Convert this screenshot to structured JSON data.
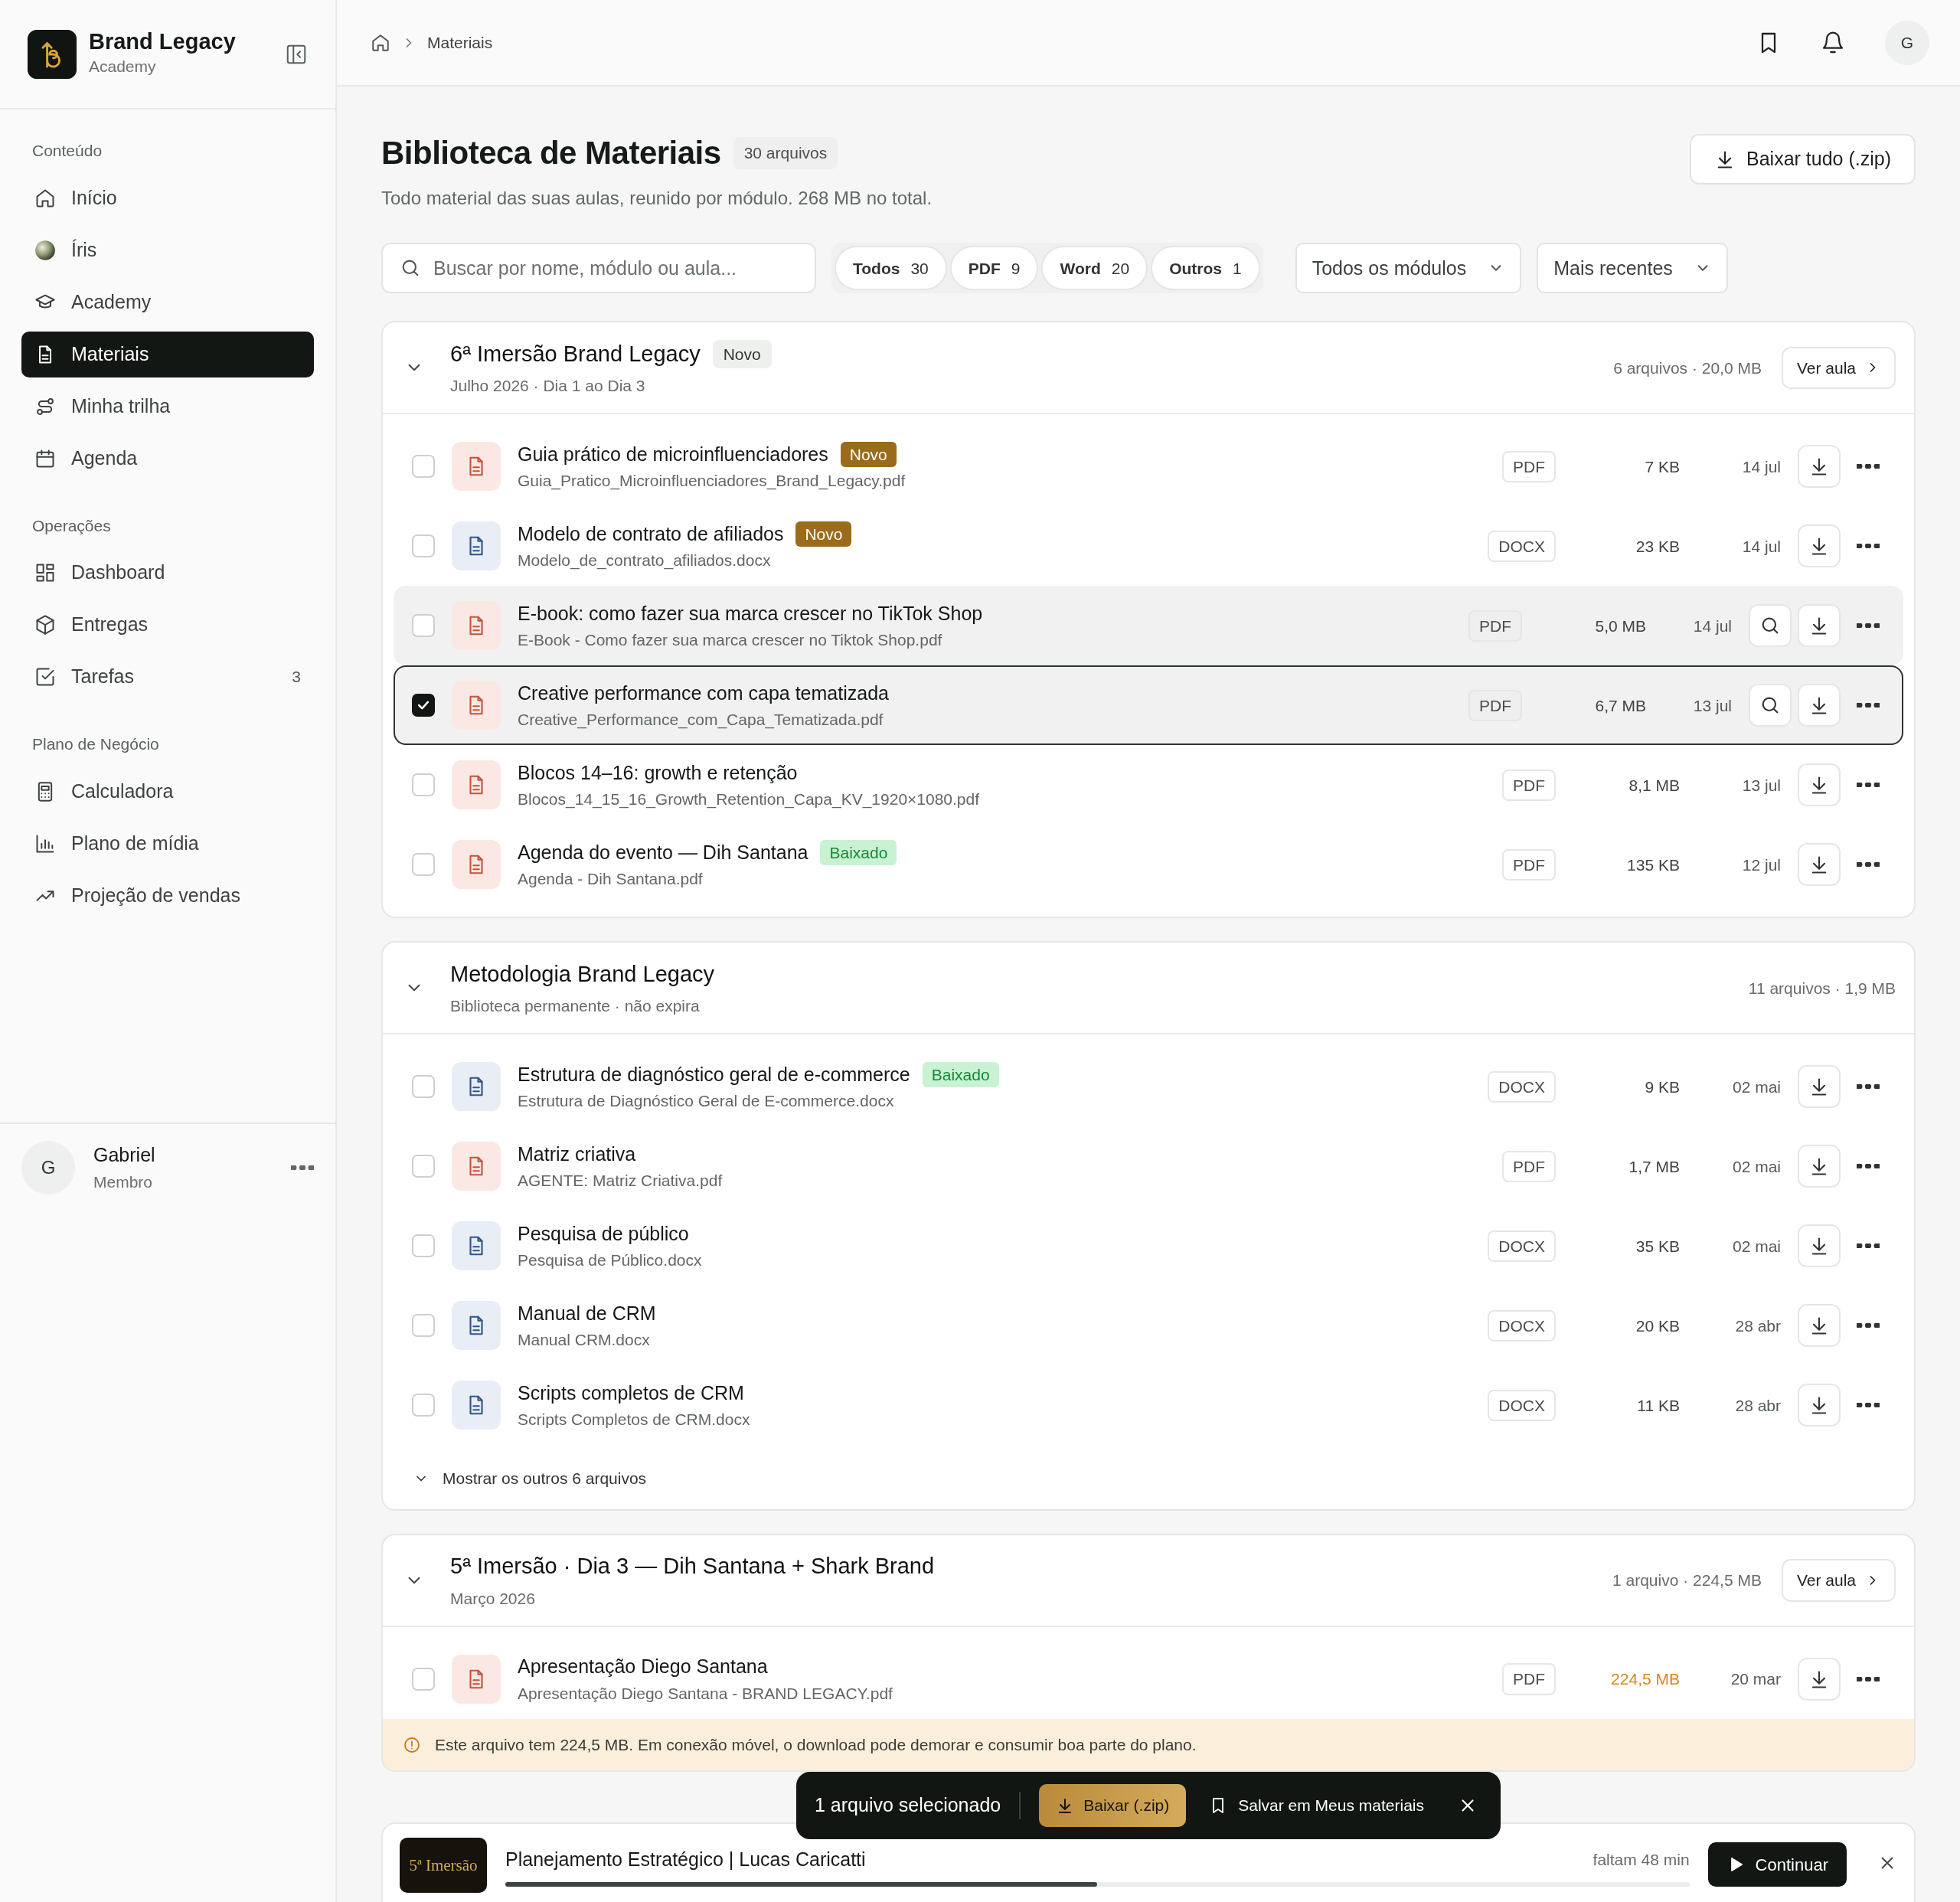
{
  "sidebar": {
    "brand": {
      "name": "Brand Legacy",
      "subtitle": "Academy"
    },
    "sections": [
      {
        "title": "Conteúdo",
        "items": [
          {
            "label": "Início",
            "selected": false
          },
          {
            "label": "Íris",
            "selected": false
          },
          {
            "label": "Academy",
            "selected": false
          },
          {
            "label": "Materiais",
            "selected": true
          },
          {
            "label": "Minha trilha",
            "selected": false
          },
          {
            "label": "Agenda",
            "selected": false
          }
        ]
      },
      {
        "title": "Operações",
        "items": [
          {
            "label": "Dashboard",
            "selected": false
          },
          {
            "label": "Entregas",
            "selected": false
          },
          {
            "label": "Tarefas",
            "selected": false,
            "count": "3"
          }
        ]
      },
      {
        "title": "Plano de Negócio",
        "items": [
          {
            "label": "Calculadora",
            "selected": false
          },
          {
            "label": "Plano de mídia",
            "selected": false
          },
          {
            "label": "Projeção de vendas",
            "selected": false
          }
        ]
      }
    ],
    "user": {
      "initial": "G",
      "name": "Gabriel",
      "role": "Membro"
    }
  },
  "topbar": {
    "breadcrumb": "Materiais",
    "avatar": "G"
  },
  "header": {
    "title": "Biblioteca de Materiais",
    "count": "30 arquivos",
    "subtitle": "Todo material das suas aulas, reunido por módulo. 268 MB no total.",
    "download_all": "Baixar tudo (.zip)"
  },
  "search": {
    "placeholder": "Buscar por nome, módulo ou aula..."
  },
  "filters": [
    {
      "label": "Todos",
      "count": "30"
    },
    {
      "label": "PDF",
      "count": "9"
    },
    {
      "label": "Word",
      "count": "20"
    },
    {
      "label": "Outros",
      "count": "1"
    }
  ],
  "dropdowns": [
    "Todos os módulos",
    "Mais recentes"
  ],
  "modules": [
    {
      "title": "6ª Imersão Brand Legacy",
      "badge": "Novo",
      "subtitle": "Julho 2026 · Dia 1 ao Dia 3",
      "meta": "6 arquivos · 20,0 MB",
      "button": "Ver aula",
      "expanded": true,
      "files": [
        {
          "kind": "pdf",
          "name": "Guia prático de microinfluenciadores",
          "badge": {
            "text": "Novo",
            "kind": "new"
          },
          "filename": "Guia_Pratico_Microinfluenciadores_Brand_Legacy.pdf",
          "ext": "PDF",
          "size": "7 KB",
          "date": "14 jul",
          "checked": false,
          "hovered": false
        },
        {
          "kind": "docx",
          "name": "Modelo de contrato de afiliados",
          "badge": {
            "text": "Novo",
            "kind": "new"
          },
          "filename": "Modelo_de_contrato_afiliados.docx",
          "ext": "DOCX",
          "size": "23 KB",
          "date": "14 jul",
          "checked": false,
          "hovered": false
        },
        {
          "kind": "pdf",
          "name": "E-book: como fazer sua marca crescer no TikTok Shop",
          "filename": "E-Book - Como fazer sua marca crescer no Tiktok Shop.pdf",
          "ext": "PDF",
          "size": "5,0 MB",
          "date": "14 jul",
          "checked": false,
          "hovered": true
        },
        {
          "kind": "pdf",
          "name": "Creative performance com capa tematizada",
          "filename": "Creative_Performance_com_Capa_Tematizada.pdf",
          "ext": "PDF",
          "size": "6,7 MB",
          "date": "13 jul",
          "checked": true,
          "hovered": false
        },
        {
          "kind": "pdf",
          "name": "Blocos 14–16: growth e retenção",
          "filename": "Blocos_14_15_16_Growth_Retention_Capa_KV_1920×1080.pdf",
          "ext": "PDF",
          "size": "8,1 MB",
          "date": "13 jul",
          "checked": false,
          "hovered": false
        },
        {
          "kind": "pdf",
          "name": "Agenda do evento — Dih Santana",
          "badge": {
            "text": "Baixado",
            "kind": "downloaded"
          },
          "filename": "Agenda - Dih Santana.pdf",
          "ext": "PDF",
          "size": "135 KB",
          "date": "12 jul",
          "checked": false,
          "hovered": false
        }
      ]
    },
    {
      "title": "Metodologia Brand Legacy",
      "subtitle": "Biblioteca permanente · não expira",
      "meta": "11 arquivos · 1,9 MB",
      "expanded": true,
      "files": [
        {
          "kind": "docx",
          "name": "Estrutura de diagnóstico geral de e-commerce",
          "badge": {
            "text": "Baixado",
            "kind": "downloaded"
          },
          "filename": "Estrutura de Diagnóstico Geral de E-commerce.docx",
          "ext": "DOCX",
          "size": "9 KB",
          "date": "02 mai",
          "checked": false,
          "hovered": false
        },
        {
          "kind": "pdf",
          "name": "Matriz criativa",
          "filename": "AGENTE: Matriz Criativa.pdf",
          "ext": "PDF",
          "size": "1,7 MB",
          "date": "02 mai",
          "checked": false,
          "hovered": false
        },
        {
          "kind": "docx",
          "name": "Pesquisa de público",
          "filename": "Pesquisa de Público.docx",
          "ext": "DOCX",
          "size": "35 KB",
          "date": "02 mai",
          "checked": false,
          "hovered": false
        },
        {
          "kind": "docx",
          "name": "Manual de CRM",
          "filename": "Manual CRM.docx",
          "ext": "DOCX",
          "size": "20 KB",
          "date": "28 abr",
          "checked": false,
          "hovered": false
        },
        {
          "kind": "docx",
          "name": "Scripts completos de CRM",
          "filename": "Scripts Completos de CRM.docx",
          "ext": "DOCX",
          "size": "11 KB",
          "date": "28 abr",
          "checked": false,
          "hovered": false
        }
      ],
      "more": "Mostrar os outros 6 arquivos"
    },
    {
      "title": "5ª Imersão · Dia 3 — Dih Santana + Shark Brand",
      "subtitle": "Março 2026",
      "meta": "1 arquivo · 224,5 MB",
      "button": "Ver aula",
      "expanded": true,
      "files": [
        {
          "kind": "pdf",
          "name": "Apresentação Diego Santana",
          "filename": "Apresentação Diego Santana - BRAND LEGACY.pdf",
          "ext": "PDF",
          "size": "224,5 MB",
          "size_warning": true,
          "date": "20 mar",
          "checked": false,
          "hovered": false
        }
      ],
      "warning": "Este arquivo tem 224,5 MB. Em conexão móvel, o download pode demorar e consumir boa parte do plano."
    }
  ],
  "selection_bar": {
    "text": "1 arquivo selecionado",
    "download": "Baixar (.zip)",
    "save": "Salvar em Meus materiais"
  },
  "player": {
    "thumb_text": "5ª Imersão",
    "title": "Planejamento Estratégico | Lucas Caricatti",
    "remaining": "faltam 48 min",
    "level": 0.5,
    "button": "Continuar"
  }
}
